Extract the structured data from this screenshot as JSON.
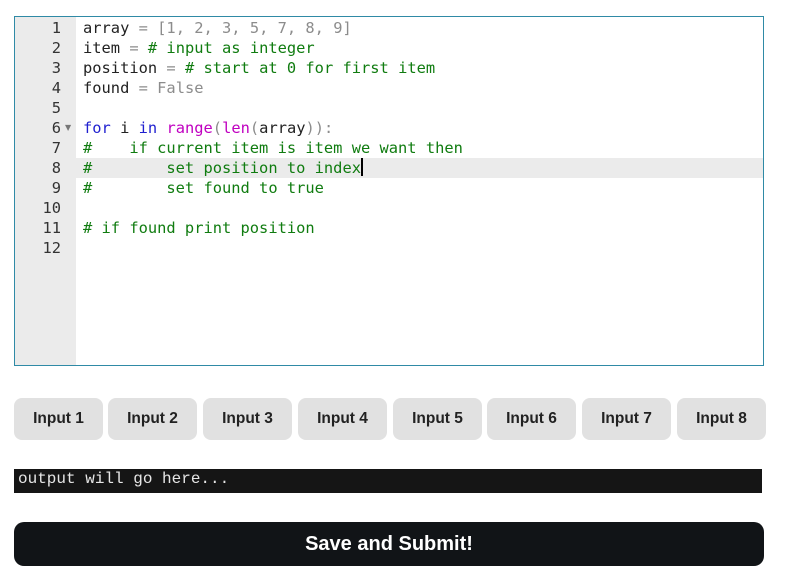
{
  "editor": {
    "lines": [
      {
        "num": "1",
        "tokens": [
          {
            "t": "array",
            "c": "ident"
          },
          {
            "t": " = ",
            "c": "punct"
          },
          {
            "t": "[1, 2, 3, 5, 7, 8, 9]",
            "c": "punct"
          }
        ]
      },
      {
        "num": "2",
        "tokens": [
          {
            "t": "item",
            "c": "ident"
          },
          {
            "t": " = ",
            "c": "punct"
          },
          {
            "t": "# input as integer",
            "c": "comment"
          }
        ]
      },
      {
        "num": "3",
        "tokens": [
          {
            "t": "position",
            "c": "ident"
          },
          {
            "t": " = ",
            "c": "punct"
          },
          {
            "t": "# start at 0 for first item",
            "c": "comment"
          }
        ]
      },
      {
        "num": "4",
        "tokens": [
          {
            "t": "found",
            "c": "ident"
          },
          {
            "t": " = ",
            "c": "punct"
          },
          {
            "t": "False",
            "c": "const"
          }
        ]
      },
      {
        "num": "5",
        "tokens": []
      },
      {
        "num": "6",
        "fold": true,
        "tokens": [
          {
            "t": "for",
            "c": "kw"
          },
          {
            "t": " i ",
            "c": "ident"
          },
          {
            "t": "in",
            "c": "kw"
          },
          {
            "t": " ",
            "c": "ident"
          },
          {
            "t": "range",
            "c": "builtin"
          },
          {
            "t": "(",
            "c": "punct"
          },
          {
            "t": "len",
            "c": "builtin"
          },
          {
            "t": "(",
            "c": "punct"
          },
          {
            "t": "array",
            "c": "ident"
          },
          {
            "t": ")):",
            "c": "punct"
          }
        ]
      },
      {
        "num": "7",
        "tokens": [
          {
            "t": "#    if current item is item we want then",
            "c": "comment"
          }
        ]
      },
      {
        "num": "8",
        "active": true,
        "cursor": true,
        "tokens": [
          {
            "t": "#        set position to index",
            "c": "comment"
          }
        ]
      },
      {
        "num": "9",
        "tokens": [
          {
            "t": "#        set found to true",
            "c": "comment"
          }
        ]
      },
      {
        "num": "10",
        "tokens": []
      },
      {
        "num": "11",
        "tokens": [
          {
            "t": "# if found print position",
            "c": "comment"
          }
        ]
      },
      {
        "num": "12",
        "tokens": []
      }
    ]
  },
  "inputs": {
    "buttons": [
      "Input 1",
      "Input 2",
      "Input 3",
      "Input 4",
      "Input 5",
      "Input 6",
      "Input 7",
      "Input 8"
    ]
  },
  "output": {
    "text": "output will go here..."
  },
  "submit": {
    "label": "Save and Submit!"
  },
  "colors": {
    "editor_border": "#2f8aa6",
    "gutter": "#ebebeb",
    "comment": "#107c10",
    "keyword": "#1f1fcf",
    "builtin": "#c000c0",
    "output_bg": "#151515",
    "submit_bg": "#111417",
    "input_button_bg": "#e1e1e1"
  }
}
